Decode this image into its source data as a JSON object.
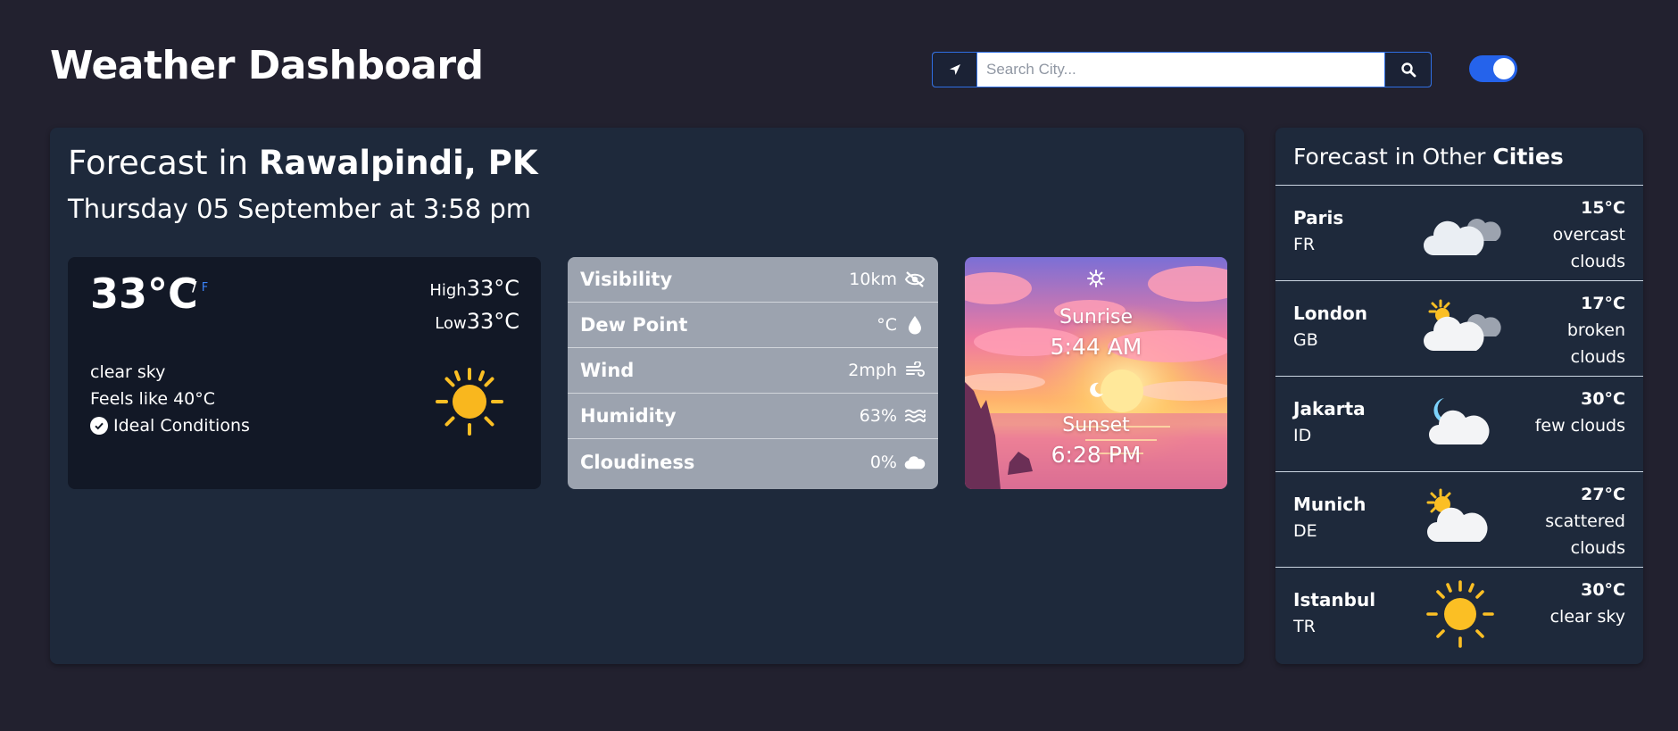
{
  "header": {
    "title": "Weather Dashboard",
    "search_placeholder": "Search City...",
    "search_value": ""
  },
  "theme": {
    "dark_mode": true,
    "accent": "#2563eb"
  },
  "main": {
    "heading_prefix": "Forecast in",
    "city": "Rawalpindi, PK",
    "datetime": "Thursday 05 September at 3:58 pm",
    "current": {
      "temp": "33°C",
      "unit_c": "/",
      "unit_f": "F",
      "high_label": "High",
      "high_value": "33°C",
      "low_label": "Low",
      "low_value": "33°C",
      "condition": "clear sky",
      "feels_like": "Feels like 40°C",
      "ideal": "Ideal Conditions",
      "icon": "sun-icon"
    },
    "details": [
      {
        "label": "Visibility",
        "value": "10km",
        "icon": "eye-slash-icon"
      },
      {
        "label": "Dew Point",
        "value": "°C",
        "icon": "droplet-icon"
      },
      {
        "label": "Wind",
        "value": "2mph",
        "icon": "wind-icon"
      },
      {
        "label": "Humidity",
        "value": "63%",
        "icon": "water-icon"
      },
      {
        "label": "Cloudiness",
        "value": "0%",
        "icon": "cloud-icon"
      }
    ],
    "sun": {
      "sunrise_label": "Sunrise",
      "sunrise_time": "5:44 AM",
      "sunset_label": "Sunset",
      "sunset_time": "6:28 PM"
    }
  },
  "cities": {
    "heading_prefix": "Forecast in Other",
    "heading_bold": "Cities",
    "items": [
      {
        "name": "Paris",
        "country": "FR",
        "temp": "15°C",
        "desc1": "overcast",
        "desc2": "clouds",
        "icon": "overcast-clouds-icon"
      },
      {
        "name": "London",
        "country": "GB",
        "temp": "17°C",
        "desc1": "broken",
        "desc2": "clouds",
        "icon": "broken-clouds-icon"
      },
      {
        "name": "Jakarta",
        "country": "ID",
        "temp": "30°C",
        "desc1": "few clouds",
        "desc2": "",
        "icon": "few-clouds-night-icon"
      },
      {
        "name": "Munich",
        "country": "DE",
        "temp": "27°C",
        "desc1": "scattered",
        "desc2": "clouds",
        "icon": "scattered-clouds-icon"
      },
      {
        "name": "Istanbul",
        "country": "TR",
        "temp": "30°C",
        "desc1": "clear sky",
        "desc2": "",
        "icon": "sun-icon"
      }
    ]
  }
}
